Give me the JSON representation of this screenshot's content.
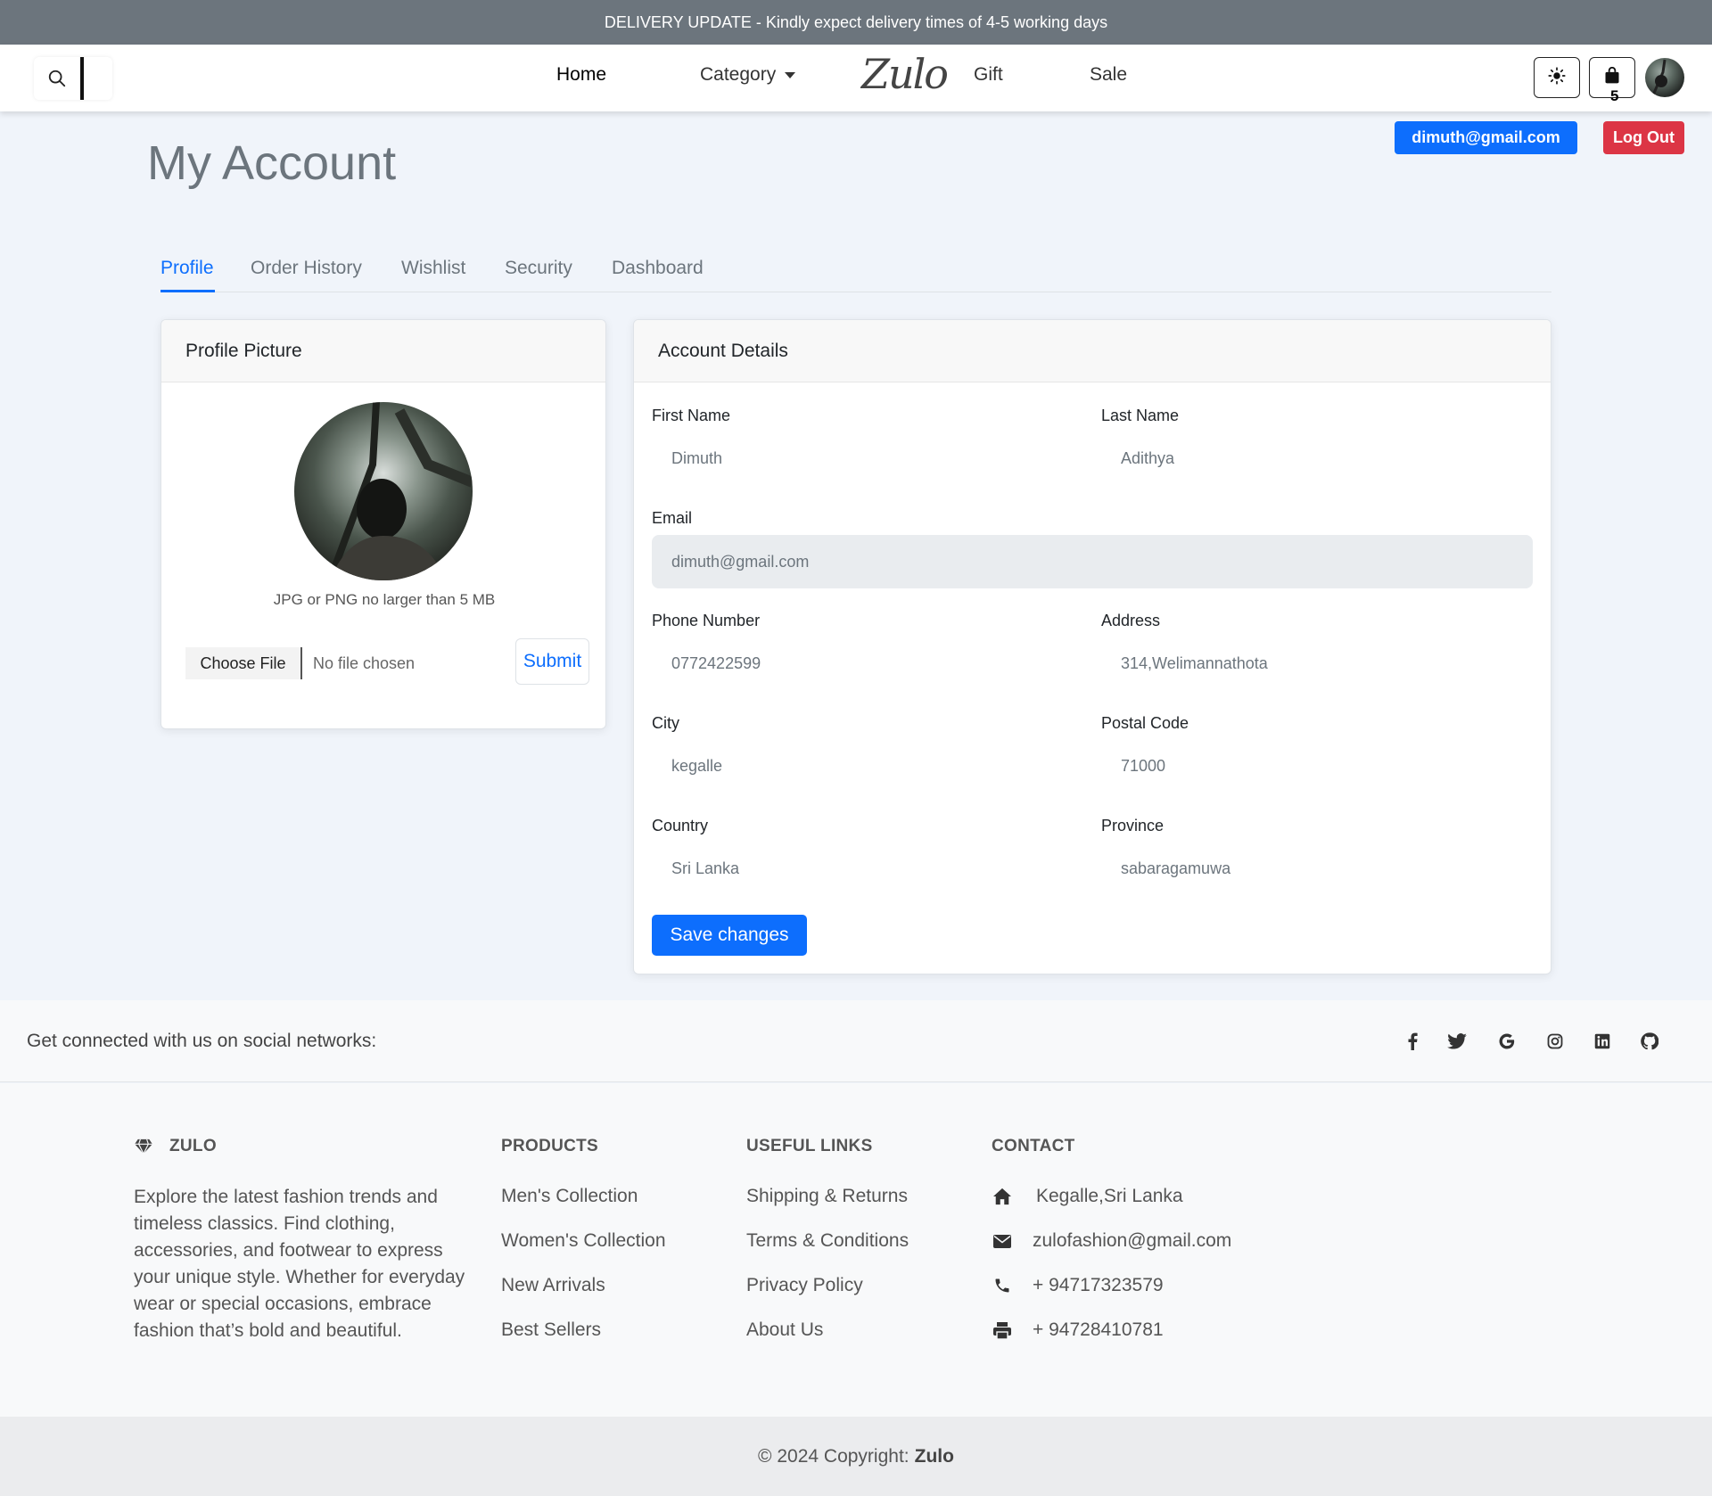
{
  "banner": {
    "text": "DELIVERY UPDATE - Kindly expect delivery times of 4-5 working days"
  },
  "nav": {
    "home": "Home",
    "category": "Category",
    "logo": "Zulo",
    "gift": "Gift",
    "sale": "Sale",
    "cart_count": "5",
    "icons": {
      "search": "search-icon",
      "theme": "sun-icon",
      "cart": "shopping-bag-icon"
    }
  },
  "account": {
    "email_badge": "dimuth@gmail.com",
    "logout": "Log Out",
    "title": "My Account"
  },
  "tabs": [
    "Profile",
    "Order History",
    "Wishlist",
    "Security",
    "Dashboard"
  ],
  "profile_card": {
    "header": "Profile Picture",
    "hint": "JPG or PNG no larger than 5 MB",
    "choose_file": "Choose File",
    "no_file": "No file chosen",
    "submit": "Submit"
  },
  "details_card": {
    "header": "Account Details",
    "fields": {
      "first_name": {
        "label": "First Name",
        "value": "Dimuth"
      },
      "last_name": {
        "label": "Last Name",
        "value": "Adithya"
      },
      "email": {
        "label": "Email",
        "value": "dimuth@gmail.com"
      },
      "phone": {
        "label": "Phone Number",
        "value": "0772422599"
      },
      "address": {
        "label": "Address",
        "value": "314,Welimannathota"
      },
      "city": {
        "label": "City",
        "value": "kegalle"
      },
      "postal": {
        "label": "Postal Code",
        "value": "71000"
      },
      "country": {
        "label": "Country",
        "value": "Sri Lanka"
      },
      "province": {
        "label": "Province",
        "value": "sabaragamuwa"
      }
    },
    "save": "Save changes"
  },
  "social": {
    "text": "Get connected with us on social networks:",
    "icons": [
      "facebook-icon",
      "twitter-icon",
      "google-icon",
      "instagram-icon",
      "linkedin-icon",
      "github-icon"
    ]
  },
  "footer": {
    "brand": "ZULO",
    "description": "Explore the latest fashion trends and timeless classics. Find clothing, accessories, and footwear to express your unique style. Whether for everyday wear or special occasions, embrace fashion that’s bold and beautiful.",
    "products_head": "PRODUCTS",
    "products": [
      "Men's Collection",
      "Women's Collection",
      "New Arrivals",
      "Best Sellers"
    ],
    "links_head": "USEFUL LINKS",
    "links": [
      "Shipping & Returns",
      "Terms & Conditions",
      "Privacy Policy",
      "About Us"
    ],
    "contact_head": "CONTACT",
    "contact": {
      "address": "Kegalle,Sri Lanka",
      "email": "zulofashion@gmail.com",
      "phone": "+ 94717323579",
      "fax": "+ 94728410781"
    },
    "copyright_prefix": "© 2024 Copyright:",
    "copyright_brand": "Zulo"
  },
  "colors": {
    "primary": "#0d6efd",
    "danger": "#dc3545",
    "banner": "#6c757d",
    "page_bg": "#f0f4fa"
  }
}
